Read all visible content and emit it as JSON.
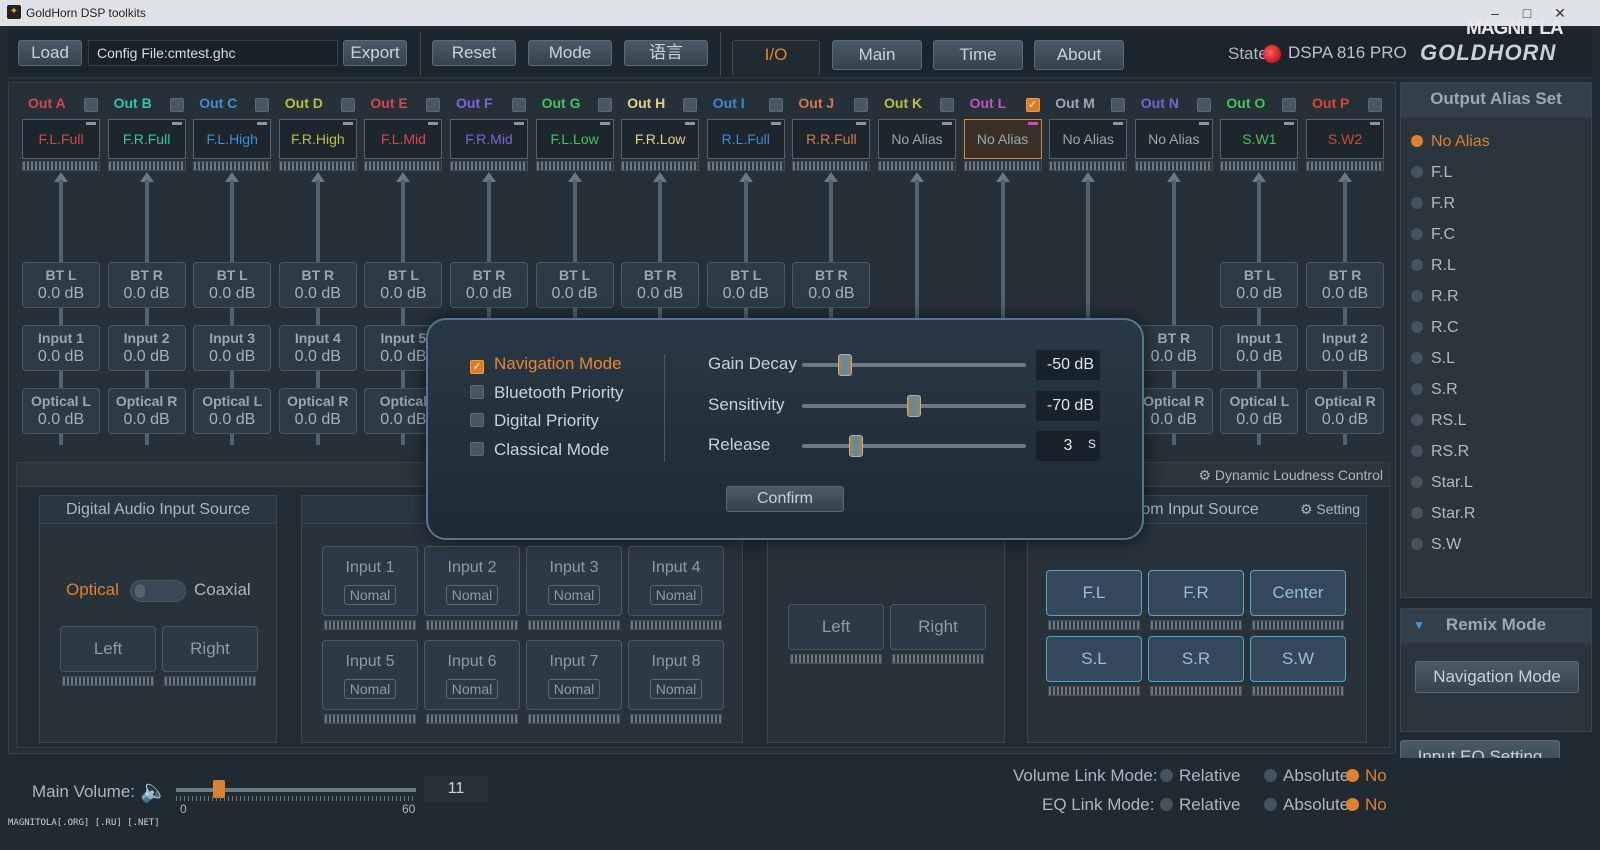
{
  "window": {
    "title": "GoldHorn DSP toolkits",
    "controls": [
      "–",
      "□",
      "✕"
    ]
  },
  "toolbar": {
    "load": "Load",
    "config_file": "Config File:cmtest.ghc",
    "export": "Export",
    "reset": "Reset",
    "mode": "Mode",
    "language": "语言",
    "tabs": [
      "I/O",
      "Main",
      "Time",
      "About"
    ],
    "active_tab": "I/O",
    "state_label": "State",
    "state_color": "#e02020",
    "model": "DSPA 816 PRO",
    "brand_logo": "GOLDHORN"
  },
  "watermark_top": "MAGNIT LA",
  "outputs": [
    {
      "name": "Out  A",
      "alias": "F.L.Full",
      "color": "#d8454f",
      "checked": false
    },
    {
      "name": "Out  B",
      "alias": "F.R.Full",
      "color": "#2fc7a6",
      "checked": false
    },
    {
      "name": "Out  C",
      "alias": "F.L.High",
      "color": "#3f8fd9",
      "checked": false
    },
    {
      "name": "Out  D",
      "alias": "F.R.High",
      "color": "#b7c23a",
      "checked": false
    },
    {
      "name": "Out  E",
      "alias": "F.L.Mid",
      "color": "#d8454f",
      "checked": false
    },
    {
      "name": "Out  F",
      "alias": "F.R.Mid",
      "color": "#7b63d8",
      "checked": false
    },
    {
      "name": "Out  G",
      "alias": "F.L.Low",
      "color": "#43c45b",
      "checked": false
    },
    {
      "name": "Out  H",
      "alias": "F.R.Low",
      "color": "#e7d18a",
      "checked": false
    },
    {
      "name": "Out  I",
      "alias": "R.L.Full",
      "color": "#4187d6",
      "checked": false
    },
    {
      "name": "Out  J",
      "alias": "R.R.Full",
      "color": "#d8774b",
      "checked": false
    },
    {
      "name": "Out  K",
      "alias": "No Alias",
      "color": "#b7c23a",
      "checked": false
    },
    {
      "name": "Out  L",
      "alias": "No Alias",
      "color": "#c650c2",
      "checked": true
    },
    {
      "name": "Out  M",
      "alias": "No Alias",
      "color": "#9aa7b2",
      "checked": false
    },
    {
      "name": "Out  N",
      "alias": "No Alias",
      "color": "#7b63d8",
      "checked": false
    },
    {
      "name": "Out  O",
      "alias": "S.W1",
      "color": "#43c45b",
      "checked": false
    },
    {
      "name": "Out  P",
      "alias": "S.W2",
      "color": "#e0442f",
      "checked": false
    }
  ],
  "input_rows": {
    "row1": [
      [
        "BT L",
        "0.0 dB"
      ],
      [
        "BT R",
        "0.0 dB"
      ],
      [
        "BT L",
        "0.0 dB"
      ],
      [
        "BT R",
        "0.0 dB"
      ],
      [
        "BT L",
        "0.0 dB"
      ],
      [
        "BT R",
        "0.0 dB"
      ],
      [
        "BT L",
        "0.0 dB"
      ],
      [
        "BT R",
        "0.0 dB"
      ],
      [
        "BT L",
        "0.0 dB"
      ],
      [
        "BT R",
        "0.0 dB"
      ],
      null,
      null,
      null,
      null,
      [
        "BT L",
        "0.0 dB"
      ],
      [
        "BT R",
        "0.0 dB"
      ]
    ],
    "row2": [
      [
        "Input 1",
        "0.0 dB"
      ],
      [
        "Input 2",
        "0.0 dB"
      ],
      [
        "Input 3",
        "0.0 dB"
      ],
      [
        "Input 4",
        "0.0 dB"
      ],
      [
        "Input 5",
        "0.0 dB"
      ],
      null,
      null,
      null,
      null,
      null,
      null,
      null,
      null,
      [
        "BT R",
        "0.0 dB"
      ],
      [
        "Input 1",
        "0.0 dB"
      ],
      [
        "Input 2",
        "0.0 dB"
      ]
    ],
    "row3": [
      [
        "Optical L",
        "0.0 dB"
      ],
      [
        "Optical R",
        "0.0 dB"
      ],
      [
        "Optical L",
        "0.0 dB"
      ],
      [
        "Optical R",
        "0.0 dB"
      ],
      [
        "Optical",
        "0.0 dB"
      ],
      null,
      null,
      null,
      null,
      null,
      null,
      null,
      null,
      [
        "Optical R",
        "0.0 dB"
      ],
      [
        "Optical L",
        "0.0 dB"
      ],
      [
        "Optical R",
        "0.0 dB"
      ]
    ]
  },
  "dlc_label": "Dynamic Loudness Control",
  "digital_source": {
    "title": "Digital Audio Input Source",
    "optical": "Optical",
    "coaxial": "Coaxial",
    "left": "Left",
    "right": "Right"
  },
  "analog_inputs": {
    "items": [
      "Input 1",
      "Input 2",
      "Input 3",
      "Input 4",
      "Input 5",
      "Input 6",
      "Input 7",
      "Input 8"
    ],
    "mode": "Nomal"
  },
  "bt_source": {
    "left": "Left",
    "right": "Right"
  },
  "atom_source": {
    "title": "atom Input Source",
    "setting": "Setting",
    "buttons": [
      "F.L",
      "F.R",
      "Center",
      "S.L",
      "S.R",
      "S.W"
    ]
  },
  "output_alias_set": {
    "title": "Output Alias Set",
    "items": [
      "No Alias",
      "F.L",
      "F.R",
      "F.C",
      "R.L",
      "R.R",
      "R.C",
      "S.L",
      "S.R",
      "RS.L",
      "RS.R",
      "Star.L",
      "Star.R",
      "S.W"
    ],
    "selected": "No Alias"
  },
  "remix": {
    "title": "Remix Mode",
    "button": "Navigation Mode"
  },
  "input_eq": "Input EQ Setting",
  "volume": {
    "label": "Main Volume:",
    "min": "0",
    "max": "60",
    "value": "11",
    "fraction": 0.18
  },
  "link_modes": {
    "volume_label": "Volume Link Mode:",
    "eq_label": "EQ Link Mode:",
    "options": [
      "Relative",
      "Absolute",
      "No"
    ],
    "selected": "No"
  },
  "bottom_watermark": "MAGNITOLA[.ORG] [.RU] [.NET]",
  "modal": {
    "options": [
      {
        "label": "Navigation Mode",
        "checked": true
      },
      {
        "label": "Bluetooth Priority",
        "checked": false
      },
      {
        "label": "Digital Priority",
        "checked": false
      },
      {
        "label": "Classical Mode",
        "checked": false
      }
    ],
    "sliders": [
      {
        "label": "Gain Decay",
        "value": "-50 dB",
        "unit": "",
        "fraction": 0.19
      },
      {
        "label": "Sensitivity",
        "value": "-70 dB",
        "unit": "",
        "fraction": 0.5
      },
      {
        "label": "Release",
        "value": "3",
        "unit": "s",
        "fraction": 0.24
      }
    ],
    "confirm": "Confirm"
  }
}
